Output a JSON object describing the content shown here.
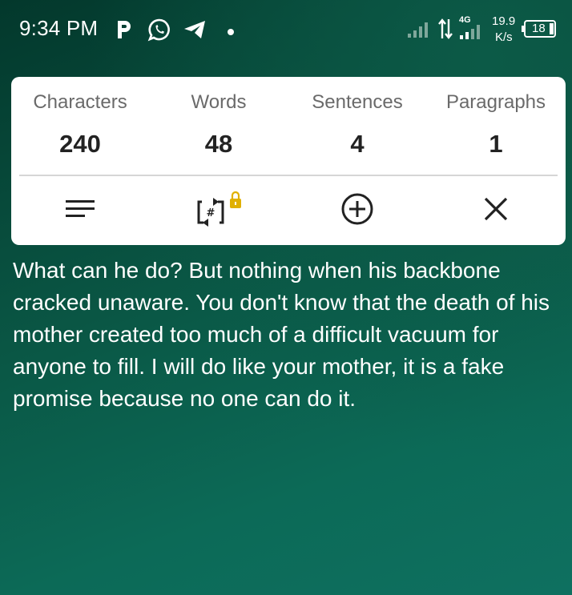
{
  "status_bar": {
    "time": "9:34 PM",
    "network_type": "4G",
    "speed_value": "19.9",
    "speed_unit": "K/s",
    "battery_level": "18"
  },
  "stats": [
    {
      "label": "Characters",
      "value": "240"
    },
    {
      "label": "Words",
      "value": "48"
    },
    {
      "label": "Sentences",
      "value": "4"
    },
    {
      "label": "Paragraphs",
      "value": "1"
    }
  ],
  "actions": {
    "icons": [
      "align-left-icon",
      "swap-hash-icon",
      "add-circle-icon",
      "close-icon"
    ],
    "lock_color": "#e0b000"
  },
  "content": {
    "text": "What can he do? But nothing when his backbone cracked unaware. You don't know that the death of his mother created too much of a difficult vacuum for anyone to fill. I will do like your mother, it is a fake promise because no one can do it."
  },
  "colors": {
    "background_top": "#03382c",
    "background_bottom": "#0e7060",
    "card": "#ffffff"
  }
}
